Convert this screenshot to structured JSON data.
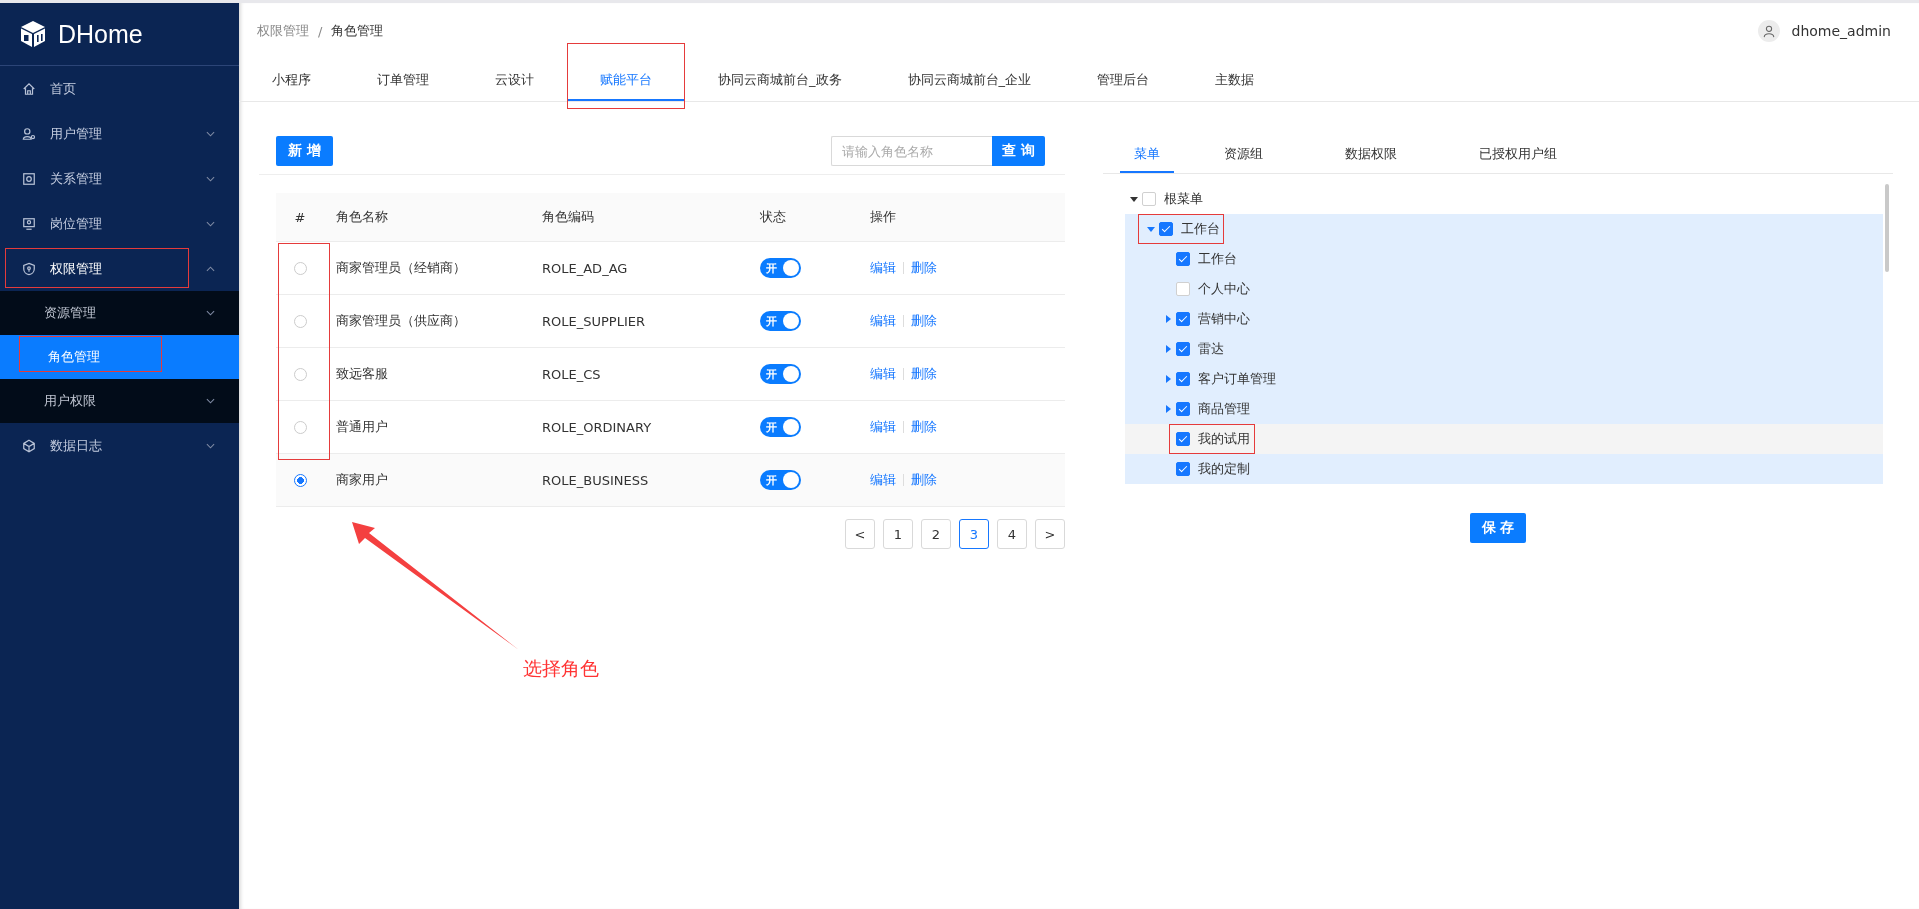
{
  "sidebar": {
    "logo": "DHome",
    "items": [
      {
        "label": "首页"
      },
      {
        "label": "用户管理",
        "expanded": false
      },
      {
        "label": "关系管理",
        "expanded": false
      },
      {
        "label": "岗位管理",
        "expanded": false
      },
      {
        "label": "权限管理",
        "expanded": true,
        "highlighted": true,
        "children": [
          {
            "label": "资源管理",
            "expanded": false,
            "selected": false
          },
          {
            "label": "角色管理",
            "selected": true,
            "highlighted": true
          },
          {
            "label": "用户权限",
            "expanded": false,
            "selected": false
          }
        ]
      },
      {
        "label": "数据日志",
        "expanded": false
      }
    ]
  },
  "header": {
    "breadcrumb": [
      "权限管理",
      "角色管理"
    ],
    "separator": "/",
    "user": "dhome_admin"
  },
  "tabs": [
    {
      "label": "小程序",
      "selected": false
    },
    {
      "label": "订单管理",
      "selected": false
    },
    {
      "label": "云设计",
      "selected": false
    },
    {
      "label": "赋能平台",
      "selected": true,
      "highlighted": true
    },
    {
      "label": "协同云商城前台_政务",
      "selected": false
    },
    {
      "label": "协同云商城前台_企业",
      "selected": false
    },
    {
      "label": "管理后台",
      "selected": false
    },
    {
      "label": "主数据",
      "selected": false
    }
  ],
  "roles": {
    "add_button": "新 增",
    "search": {
      "placeholder": "请输入角色名称",
      "button": "查 询"
    },
    "table": {
      "columns": [
        "#",
        "角色名称",
        "角色编码",
        "状态",
        "操作"
      ],
      "select_column_highlighted": true,
      "rows": [
        {
          "selected": false,
          "name": "商家管理员（经销商）",
          "code": "ROLE_AD_AG",
          "status": {
            "on": true,
            "label": "开"
          },
          "actions": [
            "编辑",
            "删除"
          ]
        },
        {
          "selected": false,
          "name": "商家管理员（供应商）",
          "code": "ROLE_SUPPLIER",
          "status": {
            "on": true,
            "label": "开"
          },
          "actions": [
            "编辑",
            "删除"
          ]
        },
        {
          "selected": false,
          "name": "致远客服",
          "code": "ROLE_CS",
          "status": {
            "on": true,
            "label": "开"
          },
          "actions": [
            "编辑",
            "删除"
          ]
        },
        {
          "selected": false,
          "name": "普通用户",
          "code": "ROLE_ORDINARY",
          "status": {
            "on": true,
            "label": "开"
          },
          "actions": [
            "编辑",
            "删除"
          ]
        },
        {
          "selected": true,
          "name": "商家用户",
          "code": "ROLE_BUSINESS",
          "status": {
            "on": true,
            "label": "开"
          },
          "actions": [
            "编辑",
            "删除"
          ]
        }
      ]
    },
    "pagination": {
      "prev": "<",
      "next": ">",
      "pages": [
        {
          "label": "1",
          "selected": false
        },
        {
          "label": "2",
          "selected": false
        },
        {
          "label": "3",
          "selected": true
        },
        {
          "label": "4",
          "selected": false
        }
      ]
    }
  },
  "permissions": {
    "tabs": [
      {
        "label": "菜单",
        "selected": true
      },
      {
        "label": "资源组",
        "selected": false
      },
      {
        "label": "数据权限",
        "selected": false
      },
      {
        "label": "已授权用户组",
        "selected": false
      }
    ],
    "tree": [
      {
        "label": "根菜单",
        "checked": false,
        "expanded": true,
        "children": [
          {
            "label": "工作台",
            "checked": true,
            "expanded": true,
            "shaded": true,
            "highlighted": true,
            "children": [
              {
                "label": "工作台",
                "checked": true
              },
              {
                "label": "个人中心",
                "checked": false
              },
              {
                "label": "营销中心",
                "checked": true,
                "expanded": false
              },
              {
                "label": "雷达",
                "checked": true,
                "expanded": false
              },
              {
                "label": "客户订单管理",
                "checked": true,
                "expanded": false
              },
              {
                "label": "商品管理",
                "checked": true,
                "expanded": false
              },
              {
                "label": "我的试用",
                "checked": true,
                "hovered": true,
                "highlighted": true
              },
              {
                "label": "我的定制",
                "checked": true
              }
            ]
          }
        ]
      }
    ],
    "save_button": "保 存"
  },
  "annotation": {
    "label": "选择角色"
  }
}
